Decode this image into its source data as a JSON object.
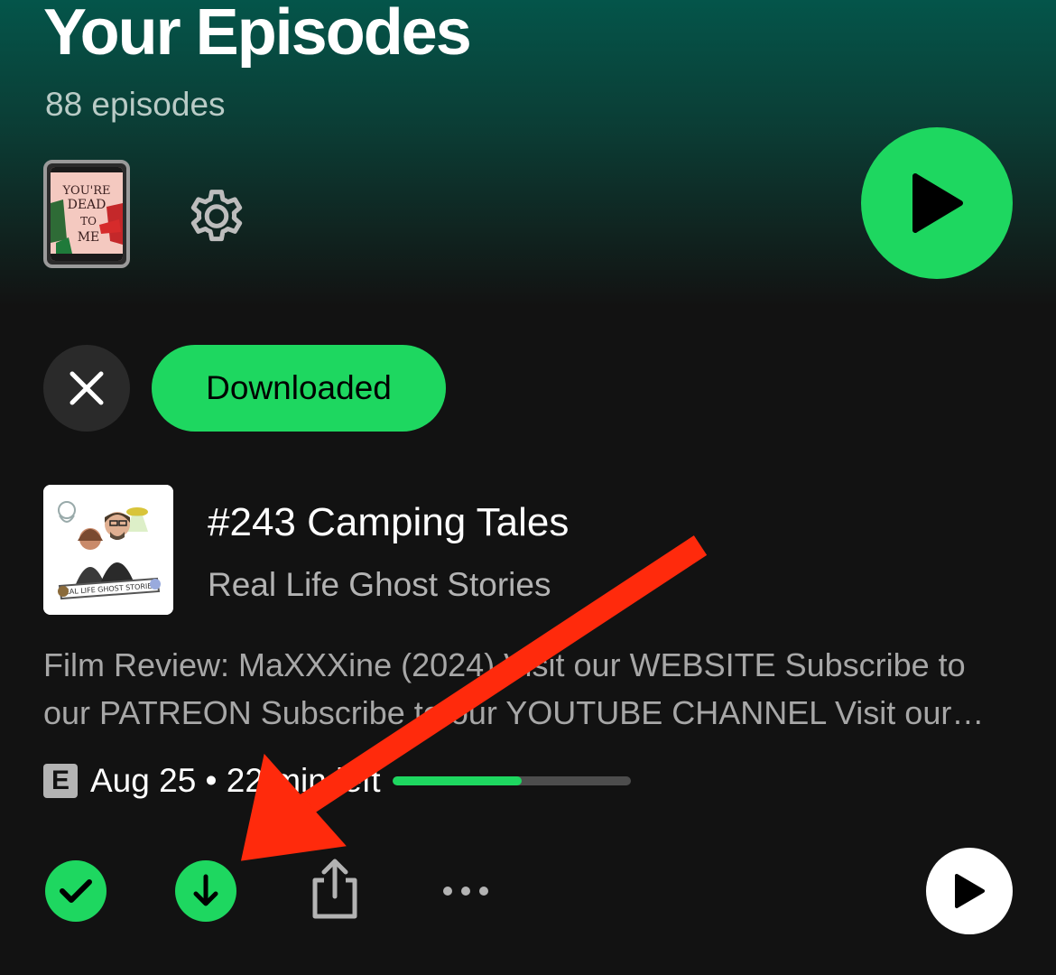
{
  "header": {
    "title": "Your Episodes",
    "episode_count": "88 episodes"
  },
  "icons": {
    "cover": "podcast-cover-icon",
    "settings": "gear-icon",
    "play": "play-icon",
    "clear": "close-icon",
    "mark_played": "check-icon",
    "download": "download-arrow-icon",
    "share": "share-icon",
    "more": "more-dots-icon"
  },
  "filter": {
    "chip_label": "Downloaded"
  },
  "episode": {
    "title": "#243 Camping Tales",
    "show": "Real Life Ghost Stories",
    "description": "Film Review: MaXXXine (2024) Visit our WEBSITE  Subscribe to our PATREON  Subscribe to our YOUTUBE CHANNEL Visit our SHOP and more",
    "explicit_badge": "E",
    "meta": "Aug 25 • 22 min left",
    "progress_fraction": 0.54
  },
  "colors": {
    "accent": "#1ed760",
    "background": "#121212",
    "header_gradient": "#04554a",
    "annotation_arrow": "#ff2a0c"
  }
}
